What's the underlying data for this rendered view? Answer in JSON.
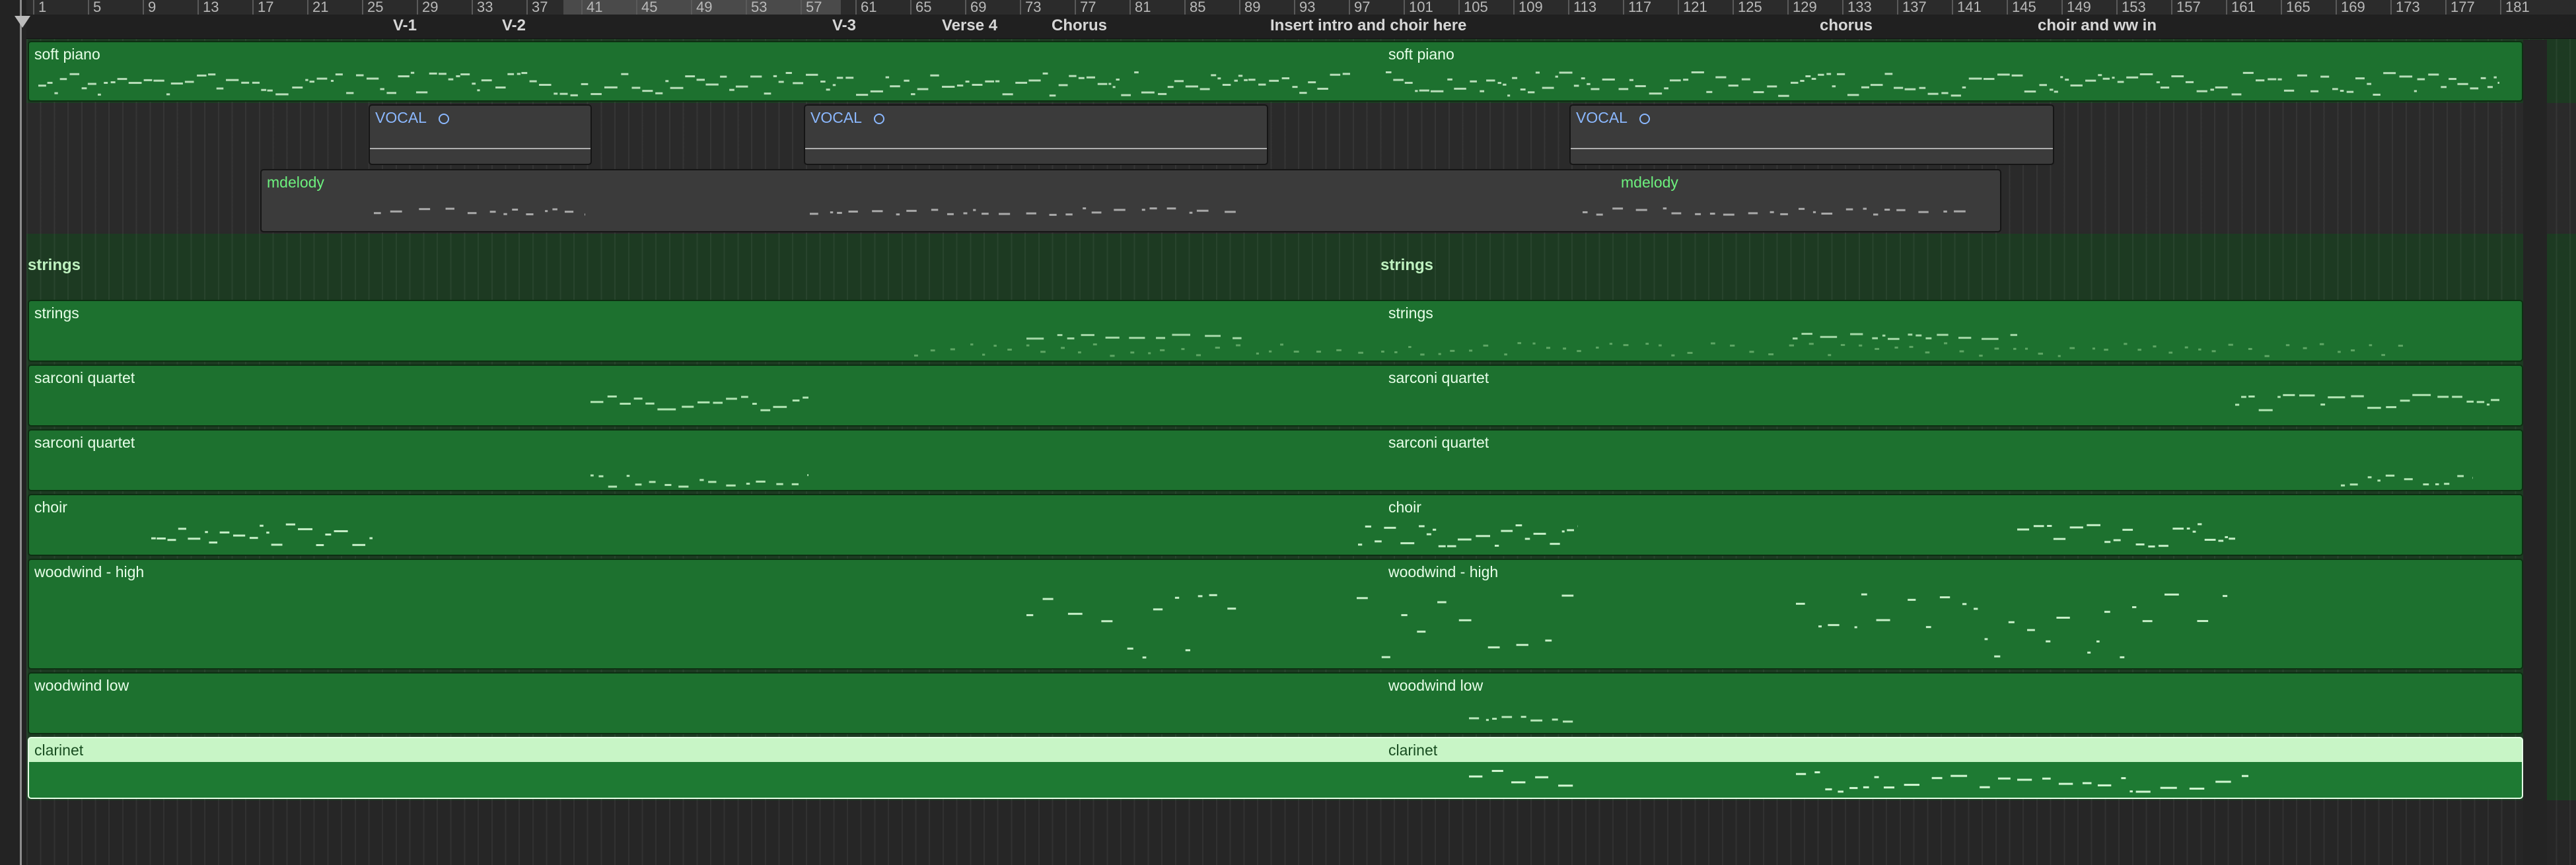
{
  "ruler": {
    "bars": [
      "1",
      "5",
      "9",
      "13",
      "17",
      "21",
      "25",
      "29",
      "33",
      "37",
      "41",
      "45",
      "49",
      "53",
      "57",
      "61",
      "65",
      "69",
      "73",
      "77",
      "81",
      "85",
      "89",
      "93",
      "97",
      "101",
      "105",
      "109",
      "113",
      "117",
      "121",
      "125",
      "129",
      "133",
      "137",
      "141",
      "145",
      "149",
      "153",
      "157",
      "161",
      "165",
      "169",
      "173",
      "177",
      "181"
    ]
  },
  "markers": [
    {
      "label": "V-1"
    },
    {
      "label": "V-2"
    },
    {
      "label": "V-3"
    },
    {
      "label": "Verse 4"
    },
    {
      "label": "Chorus"
    },
    {
      "label": "Insert intro and choir here"
    },
    {
      "label": "chorus"
    },
    {
      "label": "choir and ww in"
    }
  ],
  "folder": {
    "label": "strings"
  },
  "regions": {
    "soft_piano": "soft piano",
    "vocal": "VOCAL",
    "mdelody": "mdelody",
    "strings": "strings",
    "sarconi_quartet": "sarconi quartet",
    "choir": "choir",
    "woodwind_high": "woodwind  - high",
    "woodwind_low": "woodwind low",
    "clarinet": "clarinet"
  },
  "colors": {
    "region_green": "#1d712f",
    "region_selected": "#c8f5c6",
    "region_gray": "#3b3b3b",
    "vocal_label": "#8bb8ff",
    "melody_label": "#6df07e"
  }
}
